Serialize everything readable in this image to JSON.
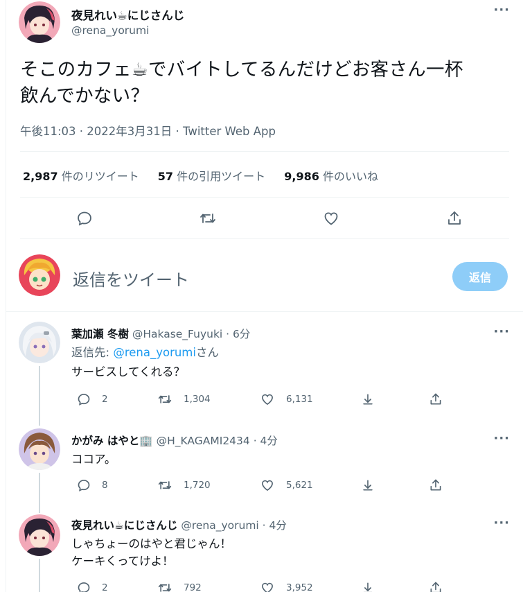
{
  "main_tweet": {
    "display_name": "夜見れい☕にじさんじ",
    "handle": "@rena_yorumi",
    "text_line1": "そこのカフェ☕でバイトしてるんだけどお客さん一杯",
    "text_line2": "飲んでかない？",
    "meta": "午後11:03 · 2022年3月31日 · Twitter Web App",
    "retweets_count": "2,987",
    "retweets_label": " 件のリツイート",
    "quotes_count": "57",
    "quotes_label": " 件の引用ツイート",
    "likes_count": "9,986",
    "likes_label": " 件のいいね",
    "more_label": "···"
  },
  "reply_box": {
    "placeholder": "返信をツイート",
    "button_label": "返信"
  },
  "replies": [
    {
      "display_name": "葉加瀬 冬樹",
      "handle_time": " @Hakase_Fuyuki · 6分",
      "replying_prefix": "返信先: ",
      "replying_handle": "@rena_yorumi",
      "replying_suffix": "さん",
      "text": "サービスしてくれる？",
      "reply_count": "2",
      "retweet_count": "1,304",
      "like_count": "6,131",
      "more_label": "···"
    },
    {
      "display_name": "かがみ はやと🏢",
      "handle_time": " @H_KAGAMI2434 · 4分",
      "text": "ココア。",
      "reply_count": "8",
      "retweet_count": "1,720",
      "like_count": "5,621",
      "more_label": "···"
    },
    {
      "display_name": "夜見れい☕にじさんじ",
      "handle_time": " @rena_yorumi · 4分",
      "text_line1": "しゃちょーのはやと君じゃん！",
      "text_line2": "ケーキくってけよ！",
      "reply_count": "2",
      "retweet_count": "792",
      "like_count": "3,952",
      "more_label": "···"
    }
  ],
  "colors": {
    "accent": "#1d9bf0",
    "reply_button": "#8ecdf8",
    "muted_text": "#536471",
    "divider": "#eff3f4"
  },
  "icons": [
    "reply-icon",
    "retweet-icon",
    "like-icon",
    "bookmark-icon",
    "share-icon",
    "more-icon"
  ]
}
